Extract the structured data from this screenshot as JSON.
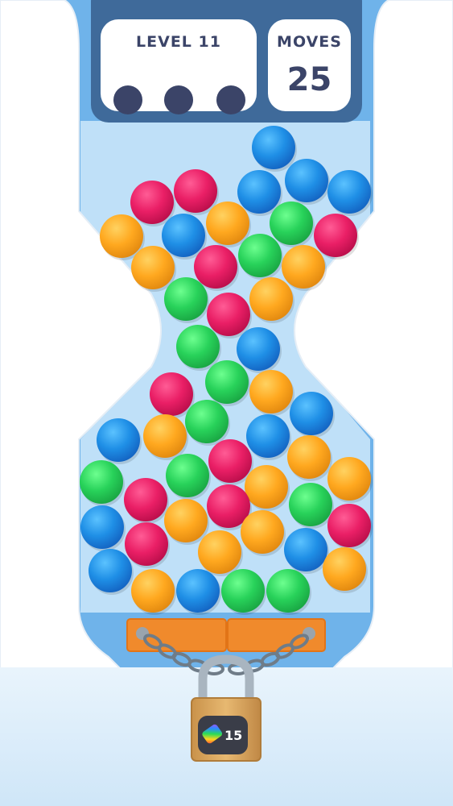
{
  "hud": {
    "level_label": "LEVEL 11",
    "level_progress": {
      "total": 3,
      "completed": 0
    },
    "moves_label": "MOVES",
    "moves_value": "25"
  },
  "lock": {
    "count": "15",
    "icon": "rainbow-stripe-icon"
  },
  "colors": {
    "sky": "#6fb3ea",
    "wall": "#ffffff",
    "container_glass": "#bfe0f8",
    "hud_panel": "#3f6a9a",
    "hud_text": "#3b4468",
    "gate": "#f08a2c",
    "floor": "#d9ecfa",
    "ball_blue": "#1f8fe6",
    "ball_red": "#ea1f66",
    "ball_green": "#28d25a",
    "ball_orange": "#ffa81f"
  },
  "balls": [
    {
      "color": "blue",
      "col": 340,
      "row": 183
    },
    {
      "color": "red",
      "col": 189,
      "row": 251
    },
    {
      "color": "red",
      "col": 243,
      "row": 237
    },
    {
      "color": "blue",
      "col": 322,
      "row": 238
    },
    {
      "color": "blue",
      "col": 381,
      "row": 224
    },
    {
      "color": "blue",
      "col": 434,
      "row": 238
    },
    {
      "color": "orange",
      "col": 151,
      "row": 293
    },
    {
      "color": "blue",
      "col": 228,
      "row": 292
    },
    {
      "color": "orange",
      "col": 283,
      "row": 277
    },
    {
      "color": "green",
      "col": 362,
      "row": 277
    },
    {
      "color": "red",
      "col": 417,
      "row": 292
    },
    {
      "color": "orange",
      "col": 190,
      "row": 332
    },
    {
      "color": "red",
      "col": 268,
      "row": 331
    },
    {
      "color": "green",
      "col": 323,
      "row": 317
    },
    {
      "color": "orange",
      "col": 377,
      "row": 331
    },
    {
      "color": "green",
      "col": 231,
      "row": 371
    },
    {
      "color": "red",
      "col": 284,
      "row": 390
    },
    {
      "color": "orange",
      "col": 337,
      "row": 371
    },
    {
      "color": "green",
      "col": 246,
      "row": 430
    },
    {
      "color": "blue",
      "col": 321,
      "row": 433
    },
    {
      "color": "red",
      "col": 213,
      "row": 489
    },
    {
      "color": "green",
      "col": 282,
      "row": 474
    },
    {
      "color": "orange",
      "col": 337,
      "row": 486
    },
    {
      "color": "green",
      "col": 257,
      "row": 523
    },
    {
      "color": "blue",
      "col": 333,
      "row": 541
    },
    {
      "color": "blue",
      "col": 387,
      "row": 513
    },
    {
      "color": "blue",
      "col": 147,
      "row": 546
    },
    {
      "color": "orange",
      "col": 205,
      "row": 541
    },
    {
      "color": "green",
      "col": 126,
      "row": 598
    },
    {
      "color": "red",
      "col": 181,
      "row": 620
    },
    {
      "color": "green",
      "col": 233,
      "row": 590
    },
    {
      "color": "red",
      "col": 286,
      "row": 572
    },
    {
      "color": "orange",
      "col": 384,
      "row": 567
    },
    {
      "color": "orange",
      "col": 434,
      "row": 594
    },
    {
      "color": "orange",
      "col": 331,
      "row": 604
    },
    {
      "color": "red",
      "col": 284,
      "row": 628
    },
    {
      "color": "green",
      "col": 386,
      "row": 626
    },
    {
      "color": "blue",
      "col": 127,
      "row": 654
    },
    {
      "color": "red",
      "col": 182,
      "row": 675
    },
    {
      "color": "orange",
      "col": 231,
      "row": 646
    },
    {
      "color": "orange",
      "col": 326,
      "row": 660
    },
    {
      "color": "red",
      "col": 434,
      "row": 652
    },
    {
      "color": "blue",
      "col": 137,
      "row": 708
    },
    {
      "color": "orange",
      "col": 273,
      "row": 685
    },
    {
      "color": "blue",
      "col": 380,
      "row": 682
    },
    {
      "color": "orange",
      "col": 428,
      "row": 706
    },
    {
      "color": "orange",
      "col": 190,
      "row": 733
    },
    {
      "color": "blue",
      "col": 246,
      "row": 733
    },
    {
      "color": "green",
      "col": 302,
      "row": 733
    },
    {
      "color": "green",
      "col": 358,
      "row": 733
    }
  ]
}
